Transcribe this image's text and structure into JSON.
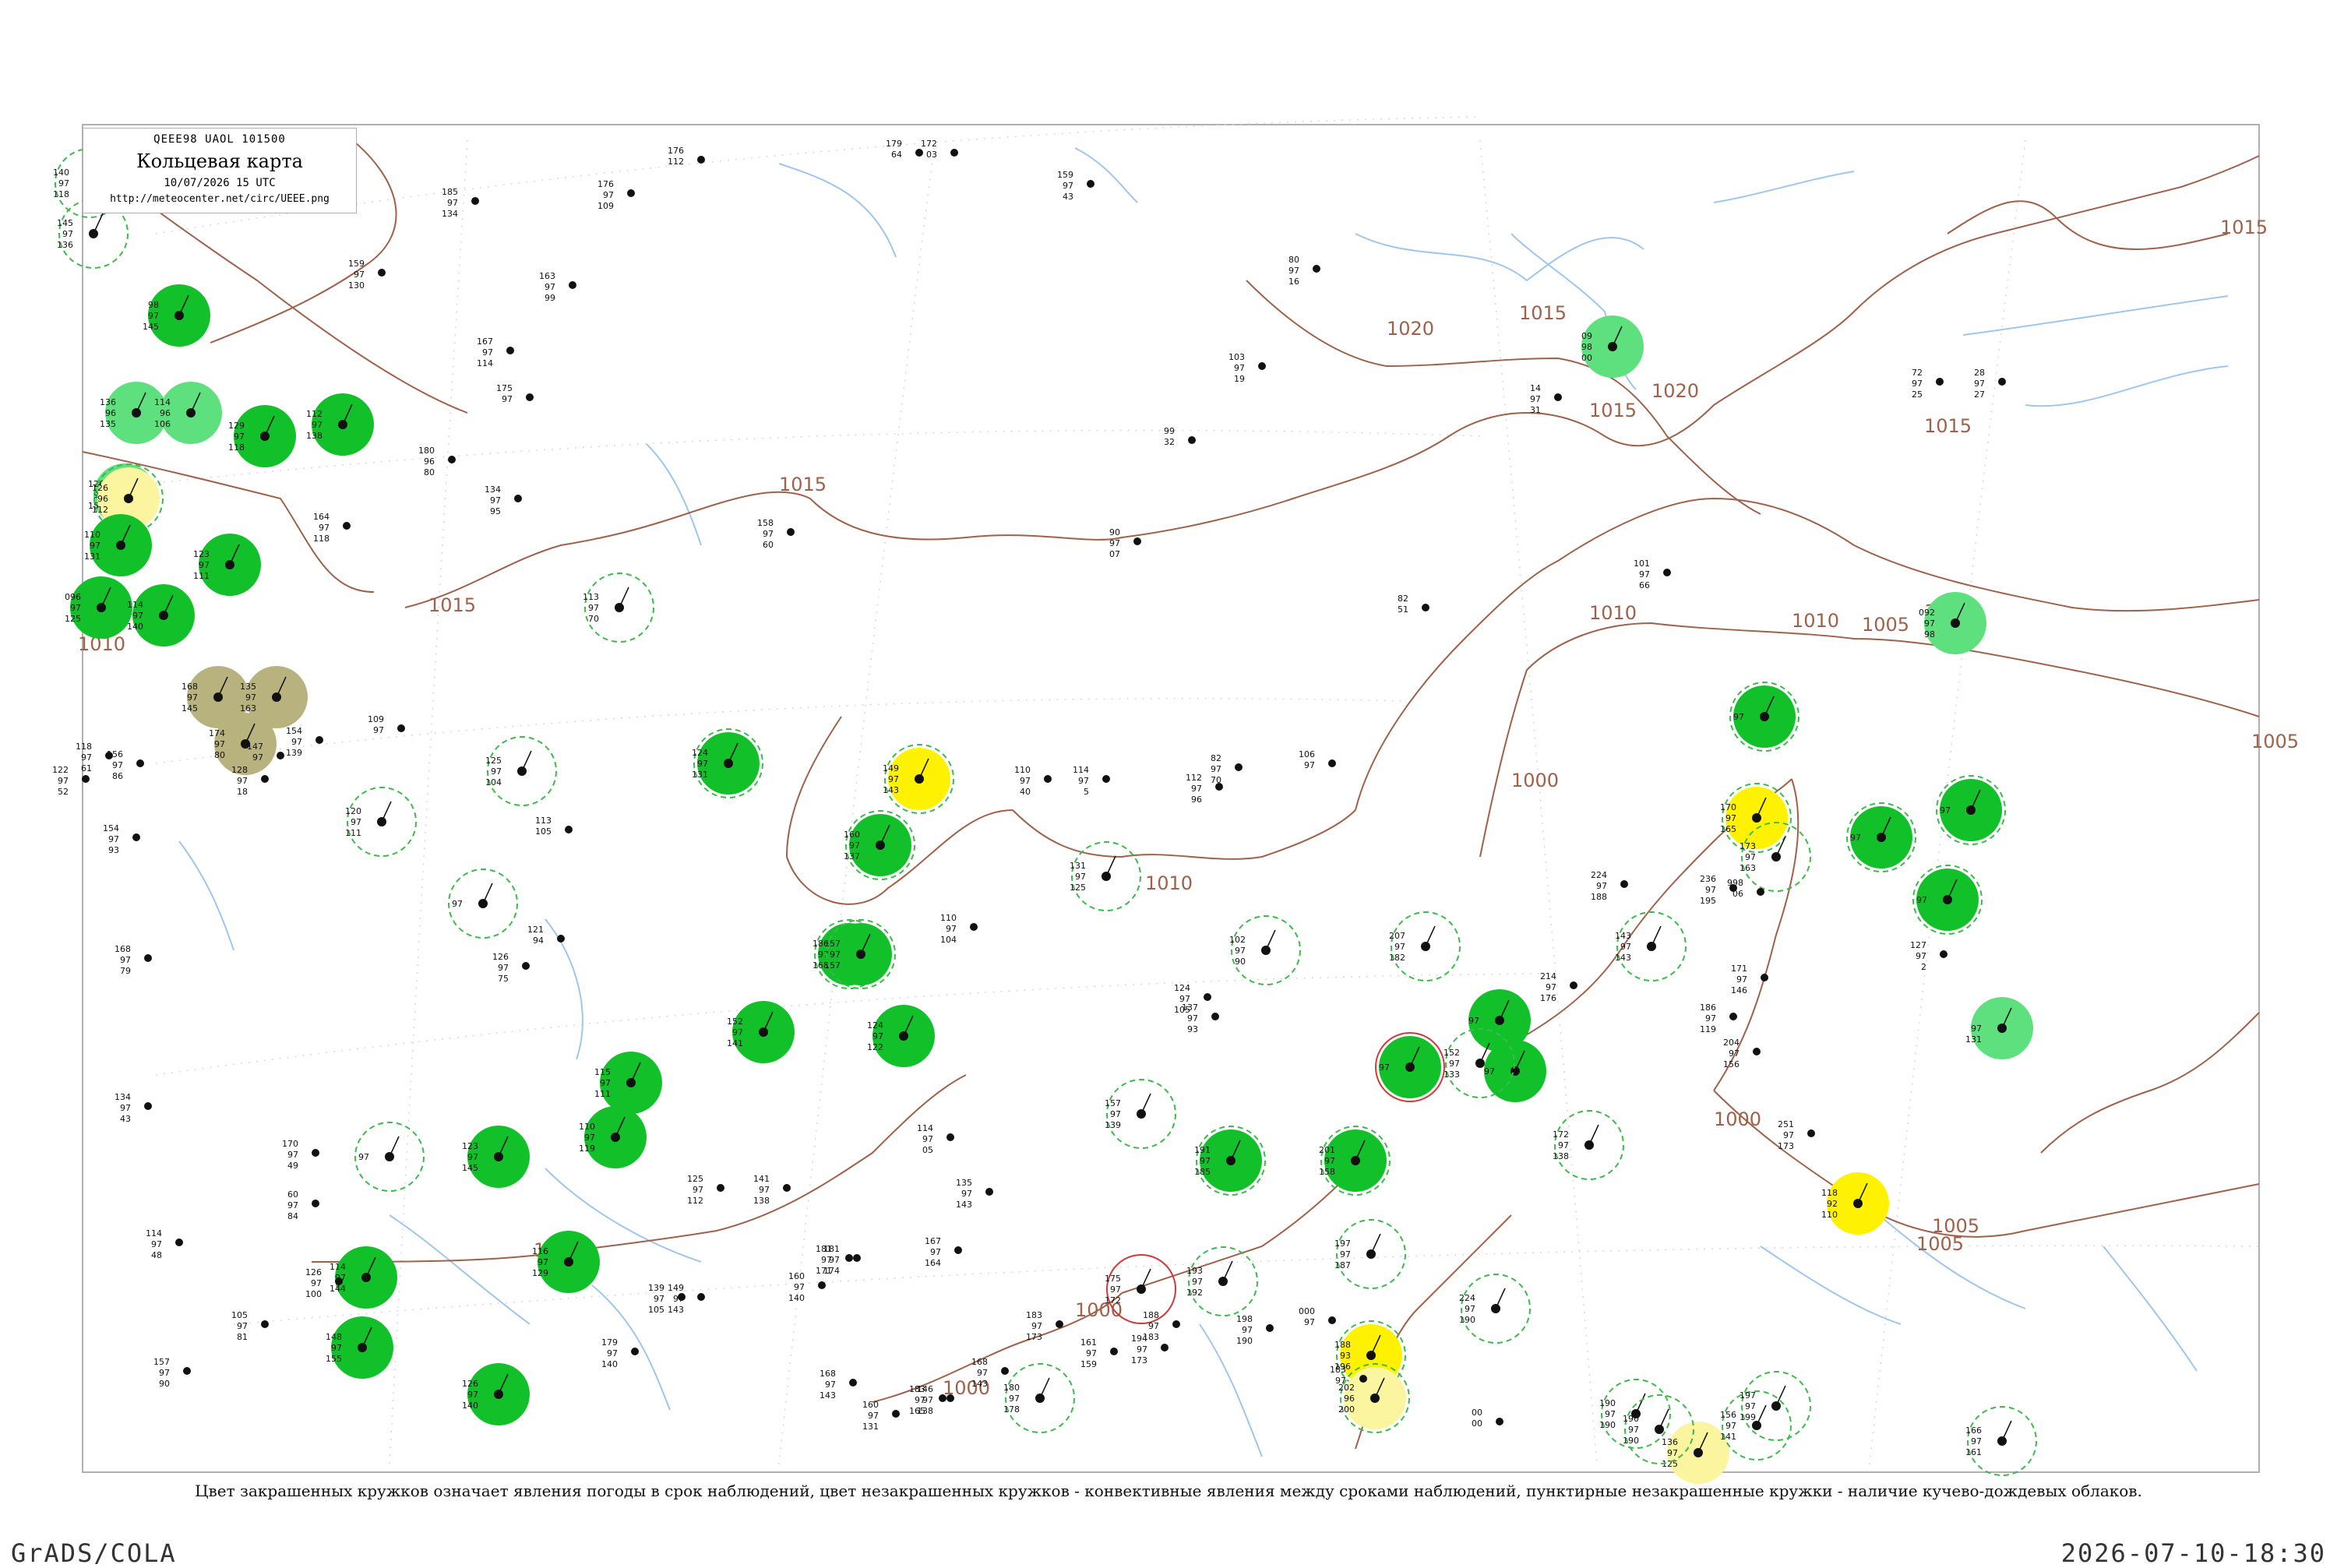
{
  "header": {
    "code": "QEEE98  UAOL  101500",
    "title": "Кольцевая карта",
    "time": "10/07/2026 15 UTC",
    "url": "http://meteocenter.net/circ/UEEE.png"
  },
  "legend": "Цвет закрашенных кружков означает явления погоды в срок наблюдений, цвет незакрашенных кружков - конвективные явления между сроками наблюдений, пунктирные незакрашенные кружки - наличие кучево-дождевых облаков.",
  "footer": {
    "left": "GrADS/COLA",
    "right": "2026-07-10-18:30"
  },
  "colors": {
    "isobar": "#a0614a",
    "river": "#9fc6ee",
    "dark_green": "#12c12a",
    "light_green": "#5fe07e",
    "yellow": "#fff200",
    "pale_yellow": "#fbf5a0",
    "olive": "#b7b27e",
    "dashed_ring": "#3cba4a",
    "red_ring": "#d23a3a"
  },
  "isobar_labels": [
    "1015",
    "1020",
    "1020",
    "1015",
    "1015",
    "1015",
    "1015",
    "1015",
    "1010",
    "1010",
    "1010",
    "1005",
    "1005",
    "1005",
    "1005",
    "1000",
    "1000",
    "1000",
    "1000",
    "1010",
    "1010",
    "1010"
  ],
  "stations": [
    {
      "fill": "dark_green",
      "ring": "none",
      "v": [
        "98",
        "97",
        "145"
      ],
      "n": "Сеймчан"
    },
    {
      "fill": "light_green",
      "ring": "none",
      "v": [
        "126",
        "96",
        "152"
      ],
      "n": ""
    },
    {
      "fill": "light_green",
      "ring": "none",
      "v": [
        "136",
        "96",
        "135"
      ],
      "n": ""
    },
    {
      "fill": "light_green",
      "ring": "none",
      "v": [
        "114",
        "96",
        "106"
      ],
      "n": ""
    },
    {
      "fill": "dark_green",
      "ring": "none",
      "v": [
        "129",
        "97",
        "118"
      ],
      "n": ""
    },
    {
      "fill": "pale_yellow",
      "ring": "dashed",
      "v": [
        "126",
        "96",
        "112"
      ],
      "n": ""
    },
    {
      "fill": "dark_green",
      "ring": "none",
      "v": [
        "110",
        "97",
        "131"
      ],
      "n": ""
    },
    {
      "fill": "dark_green",
      "ring": "none",
      "v": [
        "123",
        "97",
        "111"
      ],
      "n": ""
    },
    {
      "fill": "dark_green",
      "ring": "none",
      "v": [
        "096",
        "97",
        "125"
      ],
      "n": ""
    },
    {
      "fill": "dark_green",
      "ring": "none",
      "v": [
        "114",
        "97",
        "140"
      ],
      "n": ""
    },
    {
      "fill": "dark_green",
      "ring": "none",
      "v": [
        "112",
        "97",
        "138"
      ],
      "n": ""
    },
    {
      "fill": "olive",
      "ring": "none",
      "v": [
        "168",
        "97",
        "145"
      ],
      "n": ""
    },
    {
      "fill": "olive",
      "ring": "none",
      "v": [
        "174",
        "97",
        "80"
      ],
      "n": ""
    },
    {
      "fill": "olive",
      "ring": "none",
      "v": [
        "135",
        "97",
        "163"
      ],
      "n": ""
    },
    {
      "fill": "dark_green",
      "ring": "dashed",
      "v": [
        "124",
        "97",
        "131"
      ],
      "n": ""
    },
    {
      "fill": "yellow",
      "ring": "dashed",
      "v": [
        "149",
        "97",
        "143"
      ],
      "n": ""
    },
    {
      "fill": "dark_green",
      "ring": "dashed",
      "v": [
        "160",
        "97",
        "137"
      ],
      "n": ""
    },
    {
      "fill": "dark_green",
      "ring": "dashed",
      "v": [
        "186",
        "97",
        "168"
      ],
      "n": ""
    },
    {
      "fill": "dark_green",
      "ring": "dashed",
      "v": [
        "157",
        "97",
        "157"
      ],
      "n": ""
    },
    {
      "fill": "dark_green",
      "ring": "none",
      "v": [
        "152",
        "97",
        "141"
      ],
      "n": ""
    },
    {
      "fill": "dark_green",
      "ring": "none",
      "v": [
        "124",
        "97",
        "122"
      ],
      "n": ""
    },
    {
      "fill": "dark_green",
      "ring": "none",
      "v": [
        "115",
        "97",
        "111"
      ],
      "n": ""
    },
    {
      "fill": "dark_green",
      "ring": "none",
      "v": [
        "110",
        "97",
        "119"
      ],
      "n": ""
    },
    {
      "fill": "dark_green",
      "ring": "none",
      "v": [
        "123",
        "97",
        "145"
      ],
      "n": ""
    },
    {
      "fill": "dark_green",
      "ring": "none",
      "v": [
        "116",
        "97",
        "129"
      ],
      "n": ""
    },
    {
      "fill": "dark_green",
      "ring": "none",
      "v": [
        "114",
        "97",
        "144"
      ],
      "n": ""
    },
    {
      "fill": "dark_green",
      "ring": "none",
      "v": [
        "148",
        "97",
        "155"
      ],
      "n": ""
    },
    {
      "fill": "dark_green",
      "ring": "none",
      "v": [
        "126",
        "97",
        "140"
      ],
      "n": ""
    },
    {
      "fill": "dark_green",
      "ring": "dashed",
      "v": [
        "191",
        "97",
        "185"
      ],
      "n": ""
    },
    {
      "fill": "dark_green",
      "ring": "dashed",
      "v": [
        "201",
        "97",
        "158"
      ],
      "n": ""
    },
    {
      "fill": "dark_green",
      "ring": "red",
      "v": [
        "",
        "97",
        ""
      ],
      "n": ""
    },
    {
      "fill": "dark_green",
      "ring": "none",
      "v": [
        "",
        "97",
        ""
      ],
      "n": ""
    },
    {
      "fill": "dark_green",
      "ring": "none",
      "v": [
        "",
        "97",
        ""
      ],
      "n": ""
    },
    {
      "fill": "yellow",
      "ring": "dashed",
      "v": [
        "188",
        "93",
        "196"
      ],
      "n": ""
    },
    {
      "fill": "pale_yellow",
      "ring": "dashed",
      "v": [
        "202",
        "96",
        "200"
      ],
      "n": ""
    },
    {
      "fill": "light_green",
      "ring": "none",
      "v": [
        "09",
        "98",
        "00"
      ],
      "n": ""
    },
    {
      "fill": "dark_green",
      "ring": "dashed",
      "v": [
        "",
        "97",
        ""
      ],
      "n": ""
    },
    {
      "fill": "yellow",
      "ring": "dashed",
      "v": [
        "170",
        "97",
        "165"
      ],
      "n": ""
    },
    {
      "fill": "dark_green",
      "ring": "dashed",
      "v": [
        "",
        "97",
        ""
      ],
      "n": ""
    },
    {
      "fill": "dark_green",
      "ring": "dashed",
      "v": [
        "",
        "97",
        ""
      ],
      "n": ""
    },
    {
      "fill": "dark_green",
      "ring": "dashed",
      "v": [
        "",
        "97",
        ""
      ],
      "n": ""
    },
    {
      "fill": "light_green",
      "ring": "none",
      "v": [
        "092",
        "97",
        "98"
      ],
      "n": ""
    },
    {
      "fill": "light_green",
      "ring": "none",
      "v": [
        "",
        "97",
        "131"
      ],
      "n": ""
    },
    {
      "fill": "yellow",
      "ring": "none",
      "v": [
        "118",
        "92",
        "110"
      ],
      "n": ""
    },
    {
      "fill": "pale_yellow",
      "ring": "none",
      "v": [
        "136",
        "97",
        "125"
      ],
      "n": ""
    },
    {
      "fill": "none",
      "ring": "dashed",
      "v": [
        "140",
        "97",
        "118"
      ],
      "n": ""
    },
    {
      "fill": "none",
      "ring": "dashed",
      "v": [
        "145",
        "97",
        "136"
      ],
      "n": ""
    },
    {
      "fill": "none",
      "ring": "dashed",
      "v": [
        "113",
        "97",
        "70"
      ],
      "n": ""
    },
    {
      "fill": "none",
      "ring": "dashed",
      "v": [
        "125",
        "97",
        "104"
      ],
      "n": ""
    },
    {
      "fill": "none",
      "ring": "dashed",
      "v": [
        "131",
        "97",
        "125"
      ],
      "n": ""
    },
    {
      "fill": "none",
      "ring": "dashed",
      "v": [
        "120",
        "97",
        "111"
      ],
      "n": ""
    },
    {
      "fill": "none",
      "ring": "dashed",
      "v": [
        "102",
        "97",
        "90"
      ],
      "n": ""
    },
    {
      "fill": "none",
      "ring": "dashed",
      "v": [
        "172",
        "97",
        "138"
      ],
      "n": ""
    },
    {
      "fill": "none",
      "ring": "dashed",
      "v": [
        "173",
        "97",
        "163"
      ],
      "n": ""
    },
    {
      "fill": "none",
      "ring": "dashed",
      "v": [
        "143",
        "97",
        "143"
      ],
      "n": ""
    },
    {
      "fill": "none",
      "ring": "dashed",
      "v": [
        "156",
        "97",
        "141"
      ],
      "n": ""
    },
    {
      "fill": "none",
      "ring": "dashed",
      "v": [
        "190",
        "97",
        "190"
      ],
      "n": ""
    },
    {
      "fill": "none",
      "ring": "dashed",
      "v": [
        "197",
        "97",
        "187"
      ],
      "n": ""
    },
    {
      "fill": "none",
      "ring": "dashed",
      "v": [
        "224",
        "97",
        "190"
      ],
      "n": ""
    },
    {
      "fill": "none",
      "ring": "dashed",
      "v": [
        "157",
        "97",
        "139"
      ],
      "n": ""
    },
    {
      "fill": "none",
      "ring": "dashed",
      "v": [
        "180",
        "97",
        "178"
      ],
      "n": ""
    },
    {
      "fill": "none",
      "ring": "dashed",
      "v": [
        "193",
        "97",
        "192"
      ],
      "n": ""
    },
    {
      "fill": "none",
      "ring": "dashed",
      "v": [
        "207",
        "97",
        "182"
      ],
      "n": ""
    },
    {
      "fill": "none",
      "ring": "dashed",
      "v": [
        "190",
        "97",
        "190"
      ],
      "n": ""
    },
    {
      "fill": "none",
      "ring": "dashed",
      "v": [
        "197",
        "97",
        "199"
      ],
      "n": ""
    },
    {
      "fill": "none",
      "ring": "dashed",
      "v": [
        "166",
        "97",
        "161"
      ],
      "n": ""
    },
    {
      "fill": "none",
      "ring": "red",
      "v": [
        "175",
        "97",
        "172"
      ],
      "n": ""
    },
    {
      "fill": "none",
      "ring": "dashed",
      "v": [
        "152",
        "97",
        "133"
      ],
      "n": ""
    },
    {
      "fill": "none",
      "ring": "dashed",
      "v": [
        "",
        "97",
        ""
      ],
      "n": ""
    },
    {
      "fill": "none",
      "ring": "dashed",
      "v": [
        "",
        "97",
        ""
      ],
      "n": ""
    },
    {
      "fill": "none",
      "ring": "dashed",
      "v": [
        "",
        "97",
        ""
      ],
      "n": ""
    }
  ],
  "plain_stations": [
    {
      "v": [
        "176",
        "112",
        ""
      ]
    },
    {
      "v": [
        "179",
        "64",
        ""
      ]
    },
    {
      "v": [
        "172",
        "03",
        ""
      ]
    },
    {
      "v": [
        "159",
        "97",
        "43"
      ]
    },
    {
      "v": [
        "185",
        "97",
        "134"
      ]
    },
    {
      "v": [
        "176",
        "97",
        "109"
      ]
    },
    {
      "v": [
        "163",
        "97",
        "99"
      ]
    },
    {
      "v": [
        "159",
        "97",
        "130"
      ]
    },
    {
      "v": [
        "167",
        "97",
        "114"
      ]
    },
    {
      "v": [
        "175",
        "97",
        ""
      ]
    },
    {
      "v": [
        "180",
        "96",
        "80"
      ]
    },
    {
      "v": [
        "164",
        "97",
        "118"
      ]
    },
    {
      "v": [
        "134",
        "97",
        "95"
      ]
    },
    {
      "v": [
        "158",
        "97",
        "60"
      ]
    },
    {
      "v": [
        "103",
        "97",
        "19"
      ]
    },
    {
      "v": [
        "80",
        "97",
        "16"
      ]
    },
    {
      "v": [
        "14",
        "97",
        "31"
      ]
    },
    {
      "v": [
        "72",
        "97",
        "25"
      ]
    },
    {
      "v": [
        "28",
        "97",
        "27"
      ]
    },
    {
      "v": [
        "99",
        "32",
        ""
      ]
    },
    {
      "v": [
        "90",
        "97",
        "07"
      ]
    },
    {
      "v": [
        "82",
        "51",
        ""
      ]
    },
    {
      "v": [
        "101",
        "97",
        "66"
      ]
    },
    {
      "v": [
        "110",
        "97",
        "40"
      ]
    },
    {
      "v": [
        "114",
        "97",
        "5"
      ]
    },
    {
      "v": [
        "112",
        "97",
        "96"
      ]
    },
    {
      "v": [
        "82",
        "97",
        "70"
      ]
    },
    {
      "v": [
        "106",
        "97",
        ""
      ]
    },
    {
      "v": [
        "127",
        "97",
        "2"
      ]
    },
    {
      "v": [
        "171",
        "97",
        "146"
      ]
    },
    {
      "v": [
        "186",
        "97",
        "119"
      ]
    },
    {
      "v": [
        "204",
        "97",
        "156"
      ]
    },
    {
      "v": [
        "251",
        "97",
        "173"
      ]
    },
    {
      "v": [
        "214",
        "97",
        "176"
      ]
    },
    {
      "v": [
        "224",
        "97",
        "188"
      ]
    },
    {
      "v": [
        "236",
        "97",
        "195"
      ]
    },
    {
      "v": [
        "998",
        "06",
        ""
      ]
    },
    {
      "v": [
        "124",
        "97",
        "105"
      ]
    },
    {
      "v": [
        "137",
        "97",
        "93"
      ]
    },
    {
      "v": [
        "110",
        "97",
        "104"
      ]
    },
    {
      "v": [
        "126",
        "97",
        "75"
      ]
    },
    {
      "v": [
        "121",
        "94",
        ""
      ]
    },
    {
      "v": [
        "113",
        "105",
        ""
      ]
    },
    {
      "v": [
        "134",
        "97",
        "43"
      ]
    },
    {
      "v": [
        "168",
        "97",
        "79"
      ]
    },
    {
      "v": [
        "154",
        "97",
        "93"
      ]
    },
    {
      "v": [
        "156",
        "97",
        "86"
      ]
    },
    {
      "v": [
        "122",
        "97",
        "52"
      ]
    },
    {
      "v": [
        "118",
        "97",
        "61"
      ]
    },
    {
      "v": [
        "128",
        "97",
        "18"
      ]
    },
    {
      "v": [
        "147",
        "97",
        ""
      ]
    },
    {
      "v": [
        "154",
        "97",
        "139"
      ]
    },
    {
      "v": [
        "109",
        "97",
        ""
      ]
    },
    {
      "v": [
        "114",
        "97",
        "48"
      ]
    },
    {
      "v": [
        "157",
        "97",
        "90"
      ]
    },
    {
      "v": [
        "181",
        "97",
        "171"
      ]
    },
    {
      "v": [
        "167",
        "97",
        "164"
      ]
    },
    {
      "v": [
        "160",
        "97",
        "140"
      ]
    },
    {
      "v": [
        "168",
        "97",
        "143"
      ]
    },
    {
      "v": [
        "146",
        "97",
        "138"
      ]
    },
    {
      "v": [
        "160",
        "97",
        "131"
      ]
    },
    {
      "v": [
        "183",
        "97",
        "165"
      ]
    },
    {
      "v": [
        "183",
        "97",
        "173"
      ]
    },
    {
      "v": [
        "161",
        "97",
        "159"
      ]
    },
    {
      "v": [
        "188",
        "97",
        "183"
      ]
    },
    {
      "v": [
        "198",
        "97",
        "190"
      ]
    },
    {
      "v": [
        "000",
        "97",
        ""
      ]
    },
    {
      "v": [
        "00",
        "00",
        ""
      ]
    },
    {
      "v": [
        "105",
        "97",
        "81"
      ]
    },
    {
      "v": [
        "126",
        "97",
        "100"
      ]
    },
    {
      "v": [
        "60",
        "97",
        "84"
      ]
    },
    {
      "v": [
        "170",
        "97",
        "49"
      ]
    },
    {
      "v": [
        "125",
        "97",
        "112"
      ]
    },
    {
      "v": [
        "141",
        "97",
        "138"
      ]
    },
    {
      "v": [
        "114",
        "97",
        "05"
      ]
    },
    {
      "v": [
        "135",
        "97",
        "143"
      ]
    },
    {
      "v": [
        "194",
        "97",
        "173"
      ]
    },
    {
      "v": [
        "181",
        "97",
        "174"
      ]
    },
    {
      "v": [
        "139",
        "97",
        "105"
      ]
    },
    {
      "v": [
        "149",
        "97",
        "143"
      ]
    },
    {
      "v": [
        "179",
        "97",
        "140"
      ]
    },
    {
      "v": [
        "183",
        "97",
        ""
      ]
    },
    {
      "v": [
        "168",
        "97",
        "143"
      ]
    }
  ]
}
